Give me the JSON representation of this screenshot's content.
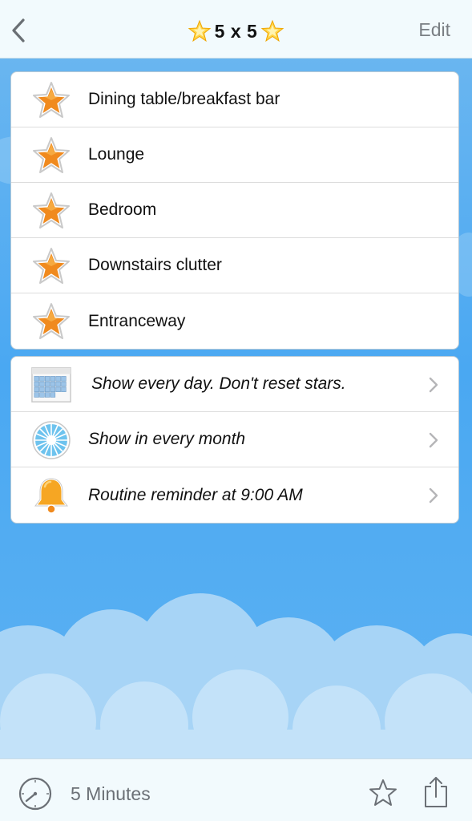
{
  "nav": {
    "back_icon": "chevron-left-icon",
    "title": "5 x 5",
    "title_icon": "glowing-star-emoji",
    "edit_label": "Edit"
  },
  "items": [
    {
      "label": "Dining table/breakfast bar",
      "icon": "star-icon"
    },
    {
      "label": "Lounge",
      "icon": "star-icon"
    },
    {
      "label": "Bedroom",
      "icon": "star-icon"
    },
    {
      "label": "Downstairs clutter",
      "icon": "star-icon"
    },
    {
      "label": "Entranceway",
      "icon": "star-icon"
    }
  ],
  "settings": [
    {
      "label": "Show every day. Don't reset stars.",
      "icon": "calendar-icon"
    },
    {
      "label": "Show in every month",
      "icon": "month-wheel-icon"
    },
    {
      "label": "Routine reminder at 9:00 AM",
      "icon": "bell-icon"
    }
  ],
  "toolbar": {
    "timer_label": "5 Minutes",
    "timer_icon": "timer-icon",
    "favorite_icon": "star-outline-icon",
    "share_icon": "share-icon"
  },
  "colors": {
    "sky": "#4aa8f2",
    "bar_background": "#f2fafd",
    "star_orange": "#f08a1e",
    "edit_gray": "#7a7f84"
  }
}
